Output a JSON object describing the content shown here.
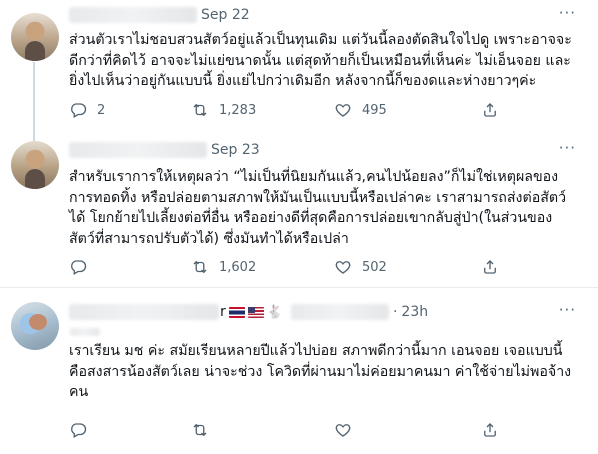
{
  "tweets": [
    {
      "date": "Sep 22",
      "more": "···",
      "text_lines": [
        "ส่วนตัวเราไม่ชอบสวนสัตว์อยู่แล้วเป็นทุนเดิม แต่วันนี้ลองตัดสินใจไปดู เพราะอาจจะ",
        "ดีกว่าที่คิดไว้ อาจจะไม่แย่ขนาดนั้น แต่สุดท้ายก็เป็นเหมือนที่เห็นค่ะ ไม่เอ็นจอย และ",
        "ยิ่งไปเห็นว่าอยู่กันแบบนี้ ยิ่งแย่ไปกว่าเดิมอีก หลังจากนี้ก็ของดและห่างยาวๆค่ะ"
      ],
      "replies": "2",
      "retweets": "1,283",
      "likes": "495"
    },
    {
      "date": "Sep 23",
      "more": "···",
      "text_lines": [
        "สำหรับเราการให้เหตุผลว่า “ไม่เป็นที่นิยมกันแล้ว,คนไปน้อยลง”ก็ไม่ใช่เหตุผลของ",
        "การทอดทิ้ง หรือปล่อยตามสภาพให้มันเป็นแบบนี้หรือเปล่าคะ เราสามารถส่งต่อสัตว์",
        "ได้ โยกย้ายไปเลี้ยงต่อที่อื่น หรืออย่างดีที่สุดคือการปล่อยเขากลับสู่ป่า(ในส่วนของ",
        "สัตว์ที่สามารถปรับตัวได้) ซึ่งมันทำได้หรือเปล่า"
      ],
      "replies": "",
      "retweets": "1,602",
      "likes": "502"
    },
    {
      "name_suffix": "r",
      "date": "23h",
      "more": "···",
      "text_lines": [
        "เราเรียน มช ค่ะ สมัยเรียนหลายปีแล้วไปบ่อย สภาพดีกว่านี้มาก เอนจอย เจอแบบนี้",
        "คือสงสารน้องสัตว์เลย น่าจะช่วง โควิดที่ผ่านมาไม่ค่อยมาคนมา ค่าใช้จ่ายไม่พอจ้าง",
        "คน"
      ],
      "replies": "",
      "retweets": "",
      "likes": ""
    }
  ],
  "icons": [
    "avatar",
    "more-icon",
    "reply-icon",
    "retweet-icon",
    "like-icon",
    "share-icon",
    "flag-thailand-icon",
    "flag-usa-icon",
    "rabbit-icon"
  ],
  "colors": {
    "text": "#0f1419",
    "muted": "#536471",
    "thread_line": "#cfd9de",
    "divider": "#e6ecf0"
  }
}
